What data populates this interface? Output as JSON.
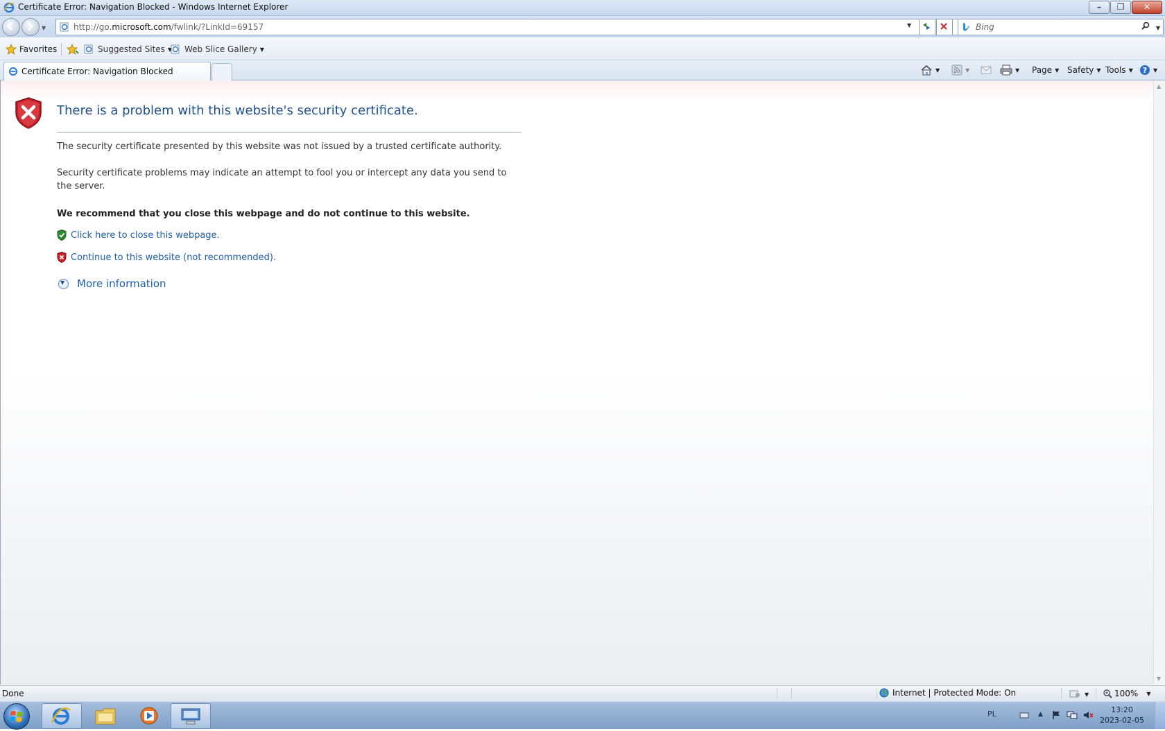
{
  "window": {
    "title": "Certificate Error: Navigation Blocked - Windows Internet Explorer",
    "controls": {
      "minimize": "–",
      "maximize": "❐",
      "close": "✕"
    }
  },
  "address_bar": {
    "url_prefix": "http://go.",
    "url_domain": "microsoft.com",
    "url_suffix": "/fwlink/?LinkId=69157",
    "search_placeholder": "Bing"
  },
  "favorites_bar": {
    "favorites_label": "Favorites",
    "items": [
      {
        "label": "Suggested Sites",
        "icon": "ie-page-icon"
      },
      {
        "label": "Web Slice Gallery",
        "icon": "ie-page-icon"
      }
    ]
  },
  "tabs": {
    "active_title": "Certificate Error: Navigation Blocked"
  },
  "command_bar": {
    "page": "Page",
    "safety": "Safety",
    "tools": "Tools"
  },
  "content": {
    "heading": "There is a problem with this website's security certificate.",
    "paragraph1": "The security certificate presented by this website was not issued by a trusted certificate authority.",
    "paragraph2": "Security certificate problems may indicate an attempt to fool you or intercept any data you send to the server.",
    "recommendation": "We recommend that you close this webpage and do not continue to this website.",
    "close_link": "Click here to close this webpage.",
    "continue_link": "Continue to this website (not recommended).",
    "more_info": "More information"
  },
  "status_bar": {
    "status": "Done",
    "zone": "Internet | Protected Mode: On",
    "zoom": "100%"
  },
  "taskbar": {
    "language": "PL",
    "time": "13:20",
    "date": "2023-02-05"
  },
  "colors": {
    "link": "#1e5fa8",
    "heading": "#1f4f8a",
    "error_red": "#c8202a",
    "safe_green": "#2f8a2f"
  }
}
